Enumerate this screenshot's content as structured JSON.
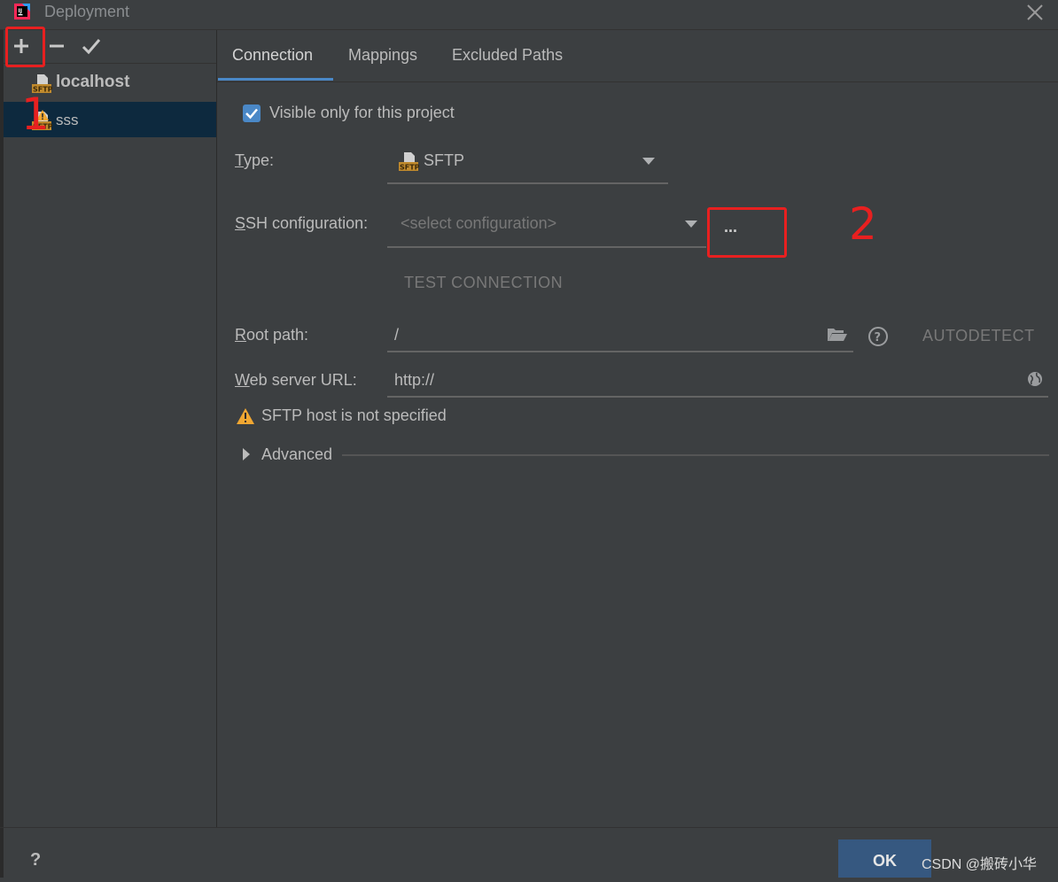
{
  "window": {
    "title": "Deployment"
  },
  "toolbar": {
    "add_icon": "plus-icon",
    "remove_icon": "minus-icon",
    "default_icon": "check-icon"
  },
  "servers": [
    {
      "label": "localhost",
      "icon": "sftp-icon",
      "bold": true
    },
    {
      "label": "sss",
      "icon": "sftp-warning-icon",
      "selected": true
    }
  ],
  "tabs": [
    {
      "label": "Connection",
      "active": true
    },
    {
      "label": "Mappings"
    },
    {
      "label": "Excluded Paths"
    }
  ],
  "connection": {
    "visible_only_label": "Visible only for this project",
    "visible_only_checked": true,
    "type_label_first": "T",
    "type_label_rest": "ype:",
    "type_value": "SFTP",
    "ssh_label_first": "S",
    "ssh_label_rest": "SH configuration:",
    "ssh_placeholder": "<select configuration>",
    "ssh_browse": "...",
    "test_connection": "TEST CONNECTION",
    "root_label_first": "R",
    "root_label_rest": "oot path:",
    "root_value": "/",
    "autodetect": "AUTODETECT",
    "web_label_first": "W",
    "web_label_rest": "eb server URL:",
    "web_value": "http://",
    "warning_text": "SFTP host is not specified",
    "advanced_label": "Advanced"
  },
  "annotations": {
    "step1": "1",
    "step2": "2"
  },
  "footer": {
    "help": "?",
    "ok": "OK",
    "watermark": "CSDN @搬砖小华"
  },
  "colors": {
    "background": "#3c3f41",
    "selection": "#0d293e",
    "accent": "#4a88c7",
    "ok_button": "#365880",
    "annotation_red": "#e82020",
    "warning": "#f0a732"
  }
}
